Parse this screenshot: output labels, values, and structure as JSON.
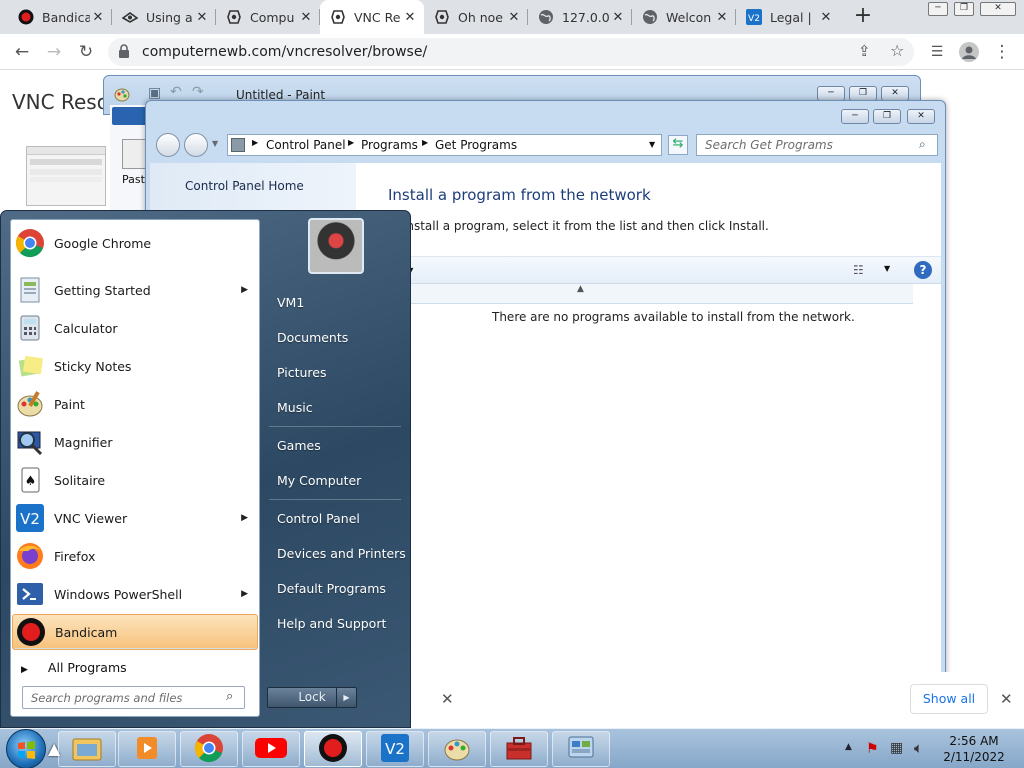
{
  "browser": {
    "tabs": [
      {
        "title": "Bandica",
        "icon": "bandicam-icon"
      },
      {
        "title": "Using a",
        "icon": "vnc-icon"
      },
      {
        "title": "Compu",
        "icon": "tux-icon"
      },
      {
        "title": "VNC Re",
        "icon": "tux-icon"
      },
      {
        "title": "Oh noe",
        "icon": "tux-icon"
      },
      {
        "title": "127.0.0",
        "icon": "globe-icon"
      },
      {
        "title": "Welcon",
        "icon": "globe-icon"
      },
      {
        "title": "Legal |",
        "icon": "vnc-viewer-icon"
      }
    ],
    "new_tab_symbol": "+",
    "url": "computernewb.com/vncresolver/browse/"
  },
  "page": {
    "title": "VNC Resol",
    "show_all": "Show all"
  },
  "paint": {
    "title": "Untitled - Paint",
    "paste_label": "Paste"
  },
  "control_panel": {
    "breadcrumb": [
      "Control Panel",
      "Programs",
      "Get Programs"
    ],
    "search_placeholder": "Search Get Programs",
    "nav_home": "Control Panel Home",
    "heading": "Install a program from the network",
    "description": "install a program, select it from the list and then click Install.",
    "toolbar_label": "e",
    "empty_message": "There are no programs available to install from the network."
  },
  "start_menu": {
    "programs": [
      {
        "label": "Google Chrome",
        "icon": "chrome-icon",
        "submenu": false
      },
      {
        "label": "Getting Started",
        "icon": "getting-started-icon",
        "submenu": true
      },
      {
        "label": "Calculator",
        "icon": "calculator-icon",
        "submenu": false
      },
      {
        "label": "Sticky Notes",
        "icon": "sticky-notes-icon",
        "submenu": false
      },
      {
        "label": "Paint",
        "icon": "paint-icon",
        "submenu": false
      },
      {
        "label": "Magnifier",
        "icon": "magnifier-icon",
        "submenu": false
      },
      {
        "label": "Solitaire",
        "icon": "solitaire-icon",
        "submenu": false
      },
      {
        "label": "VNC Viewer",
        "icon": "vnc-viewer-icon",
        "submenu": true
      },
      {
        "label": "Firefox",
        "icon": "firefox-icon",
        "submenu": false
      },
      {
        "label": "Windows PowerShell",
        "icon": "powershell-icon",
        "submenu": true
      },
      {
        "label": "Bandicam",
        "icon": "bandicam-icon",
        "submenu": false,
        "highlighted": true
      }
    ],
    "all_programs": "All Programs",
    "search_placeholder": "Search programs and files",
    "right_links": [
      "VM1",
      "Documents",
      "Pictures",
      "Music",
      "Games",
      "My Computer",
      "Control Panel",
      "Devices and Printers",
      "Default Programs",
      "Help and Support"
    ],
    "lock_label": "Lock"
  },
  "taskbar": {
    "apps": [
      "explorer-icon",
      "media-player-icon",
      "chrome-icon",
      "youtube-icon",
      "bandicam-icon",
      "vnc-viewer-icon",
      "paint-icon",
      "toolbox-icon",
      "control-panel-icon"
    ],
    "time": "2:56 AM",
    "date": "2/11/2022"
  }
}
